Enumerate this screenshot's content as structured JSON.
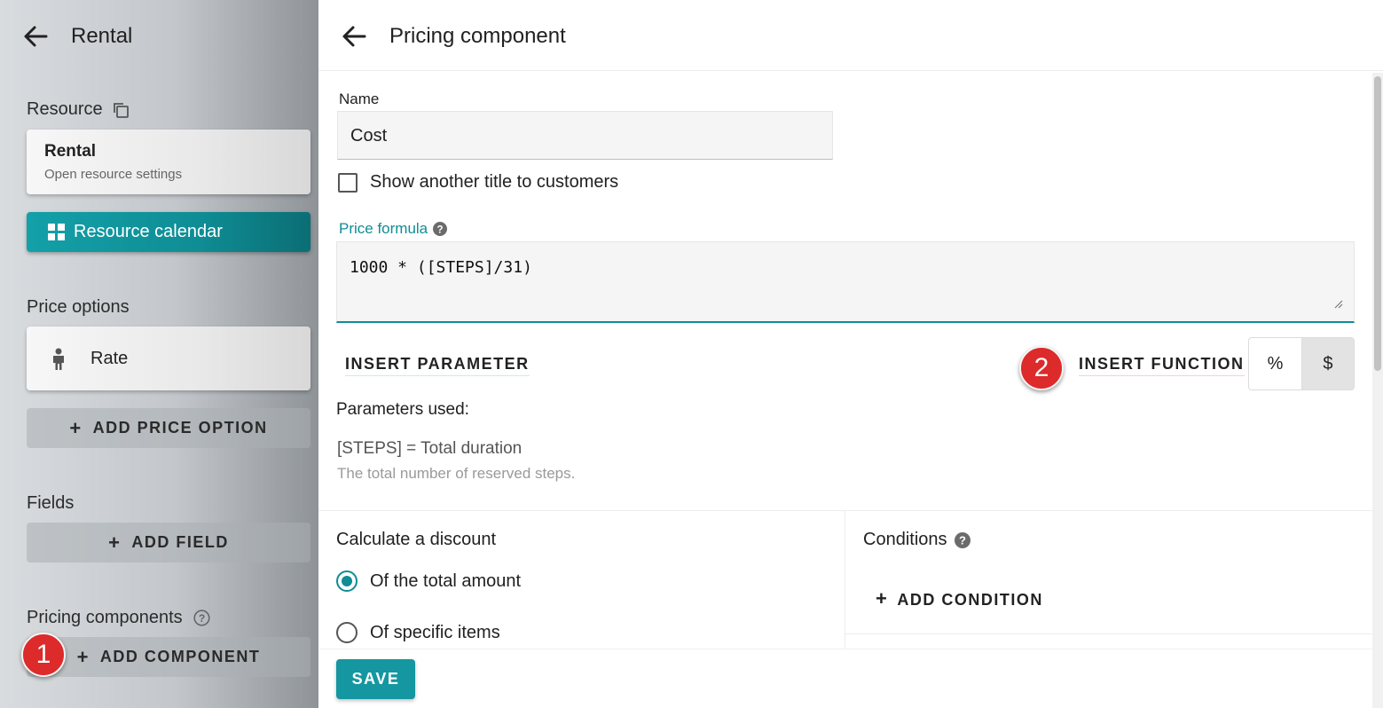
{
  "left_panel": {
    "title": "Rental",
    "resource_section_label": "Resource",
    "resource_card": {
      "title": "Rental",
      "subtitle": "Open resource settings"
    },
    "calendar_button_label": "Resource calendar",
    "price_options_label": "Price options",
    "price_option_item": {
      "label": "Rate",
      "icon": "person-icon"
    },
    "add_price_option_label": "ADD PRICE OPTION",
    "fields_label": "Fields",
    "add_field_label": "ADD FIELD",
    "pricing_components_label": "Pricing components",
    "add_component_label": "ADD COMPONENT",
    "badge_1": "1"
  },
  "main": {
    "title": "Pricing component",
    "name_label": "Name",
    "name_value": "Cost",
    "show_title_checkbox_label": "Show another title to customers",
    "show_title_checked": false,
    "price_formula_label": "Price formula",
    "price_formula_value": "1000 * ([STEPS]/31)",
    "insert_parameter_label": "INSERT PARAMETER",
    "insert_function_label": "INSERT FUNCTION",
    "badge_2": "2",
    "toggle": {
      "percent": "%",
      "dollar": "$",
      "selected": "$"
    },
    "params_used_label": "Parameters used:",
    "param_token": "[STEPS]",
    "param_equals": "= Total duration",
    "param_description": "The total number of reserved steps.",
    "discount_label": "Calculate a discount",
    "discount_options": [
      {
        "label": "Of the total amount",
        "selected": true
      },
      {
        "label": "Of specific items",
        "selected": false
      }
    ],
    "conditions_label": "Conditions",
    "add_condition_label": "ADD CONDITION",
    "save_label": "SAVE"
  },
  "colors": {
    "accent": "#0f8d95",
    "badge": "#dd2a2a"
  }
}
